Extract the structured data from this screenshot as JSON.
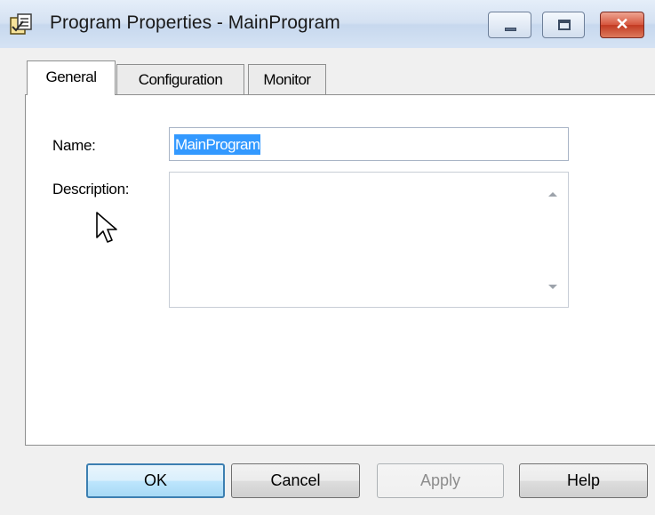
{
  "window": {
    "title": "Program Properties - MainProgram",
    "icon": "program-properties-icon",
    "controls": {
      "minimize": "minimize-icon",
      "maximize": "maximize-icon",
      "close": "✕"
    }
  },
  "tabs": [
    {
      "label": "General",
      "selected": true
    },
    {
      "label": "Configuration",
      "selected": false
    },
    {
      "label": "Monitor",
      "selected": false
    }
  ],
  "general": {
    "name_label": "Name:",
    "name_value": "MainProgram",
    "description_label": "Description:",
    "description_value": ""
  },
  "buttons": {
    "ok": "OK",
    "cancel": "Cancel",
    "apply": "Apply",
    "help": "Help"
  },
  "colors": {
    "selection": "#3399ff",
    "close_button": "#c23a22",
    "default_button_border": "#3c7fb1"
  }
}
